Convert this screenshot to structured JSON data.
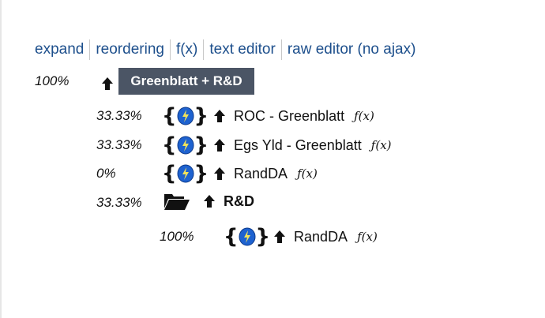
{
  "tabs": [
    "expand",
    "reordering",
    "f(x)",
    "text editor",
    "raw editor (no ajax)"
  ],
  "root": {
    "pct": "100%",
    "label": "Greenblatt + R&D"
  },
  "items": [
    {
      "pct": "33.33%",
      "label": "ROC - Greenblatt",
      "fx": "ƒ(x)"
    },
    {
      "pct": "33.33%",
      "label": "Egs Yld - Greenblatt",
      "fx": "ƒ(x)"
    },
    {
      "pct": "0%",
      "label": "RandDA",
      "fx": "ƒ(x)"
    },
    {
      "pct": "33.33%",
      "label": "R&D"
    }
  ],
  "child": {
    "pct": "100%",
    "label": "RandDA",
    "fx": "ƒ(x)"
  },
  "icons": {
    "arrow": "up-arrow-icon",
    "config": "braces-orb-icon",
    "folder": "open-folder-icon"
  },
  "colors": {
    "tab_link": "#1d4f8c",
    "root_bg": "#4b5565",
    "orb_blue": "#1e62d0",
    "orb_bolt": "#f2e25a"
  }
}
